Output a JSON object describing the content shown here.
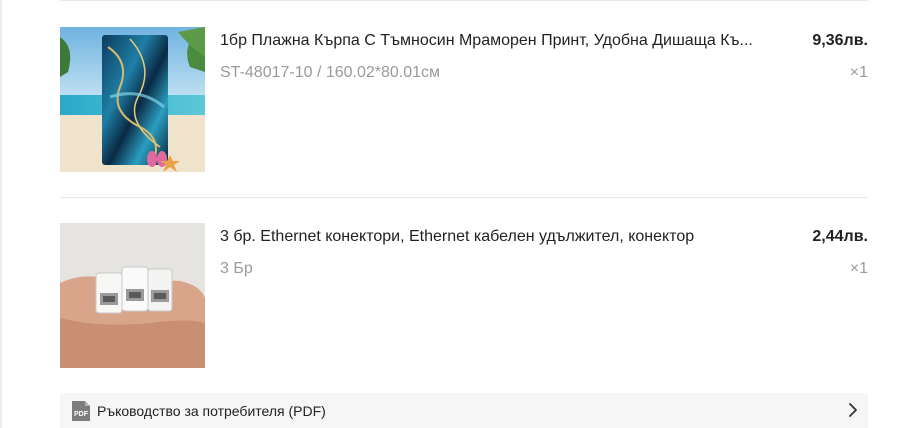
{
  "items": [
    {
      "title": "1бр Плажна Кърпа С Тъмносин Мраморен Принт, Удобна Дишаща Къ...",
      "variant": "ST-48017-10 / 160.02*80.01см",
      "price": "9,36лв.",
      "quantity": "×1",
      "image": "beach-towel-photo"
    },
    {
      "title": "3 бр. Ethernet конектори, Ethernet кабелен удължител, конектор",
      "variant": "3 Бр",
      "price": "2,44лв.",
      "quantity": "×1",
      "image": "ethernet-connectors-photo"
    }
  ],
  "manual": {
    "icon_text": "PDF",
    "label": "Ръководство за потребителя (PDF)",
    "icon": "pdf-icon",
    "arrow_icon": "chevron-right-icon"
  }
}
